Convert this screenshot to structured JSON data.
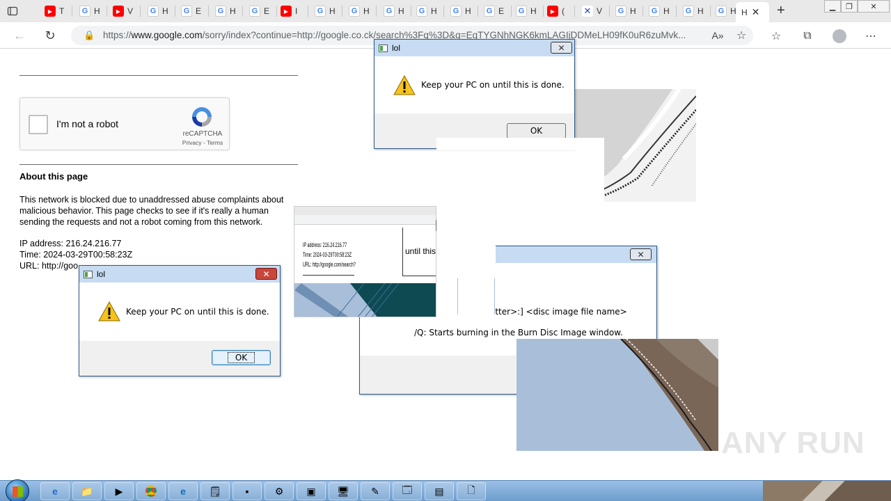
{
  "browser": {
    "tabs": [
      {
        "fav": "yt",
        "label": "T"
      },
      {
        "fav": "g",
        "label": "H"
      },
      {
        "fav": "yt",
        "label": "V"
      },
      {
        "fav": "g",
        "label": "H"
      },
      {
        "fav": "g",
        "label": "E"
      },
      {
        "fav": "g",
        "label": "H"
      },
      {
        "fav": "g",
        "label": "E"
      },
      {
        "fav": "yt",
        "label": "I"
      },
      {
        "fav": "g",
        "label": "H"
      },
      {
        "fav": "g",
        "label": "H"
      },
      {
        "fav": "g",
        "label": "H"
      },
      {
        "fav": "g",
        "label": "H"
      },
      {
        "fav": "g",
        "label": "H"
      },
      {
        "fav": "g",
        "label": "E"
      },
      {
        "fav": "g",
        "label": "H"
      },
      {
        "fav": "yt",
        "label": "("
      },
      {
        "fav": "x",
        "label": "V"
      },
      {
        "fav": "g",
        "label": "H"
      },
      {
        "fav": "g",
        "label": "H"
      },
      {
        "fav": "g",
        "label": "H"
      },
      {
        "fav": "g",
        "label": "H"
      }
    ],
    "active_tab_label": "H",
    "url_prefix": "https://",
    "url_domain": "www.google.com",
    "url_rest": "/sorry/index?continue=http://google.co.ck/search%3Fq%3D&q=EgTYGNhNGK6kmLAGIjDDMeLH09fK0uR6zuMvk..."
  },
  "page": {
    "recaptcha": {
      "label": "I'm not a robot",
      "brand": "reCAPTCHA",
      "links": "Privacy - Terms"
    },
    "about_title": "About this page",
    "about_text": "This network is blocked due to unaddressed abuse complaints about malicious behavior. This page checks to see if it's really a human sending the requests and not a robot coming from this network.",
    "ip_line": "IP address: 216.24.216.77",
    "time_line": "Time: 2024-03-29T00:58:23Z",
    "url_line": "URL: http://goo"
  },
  "dialogs": {
    "top": {
      "title": "lol",
      "message": "Keep your PC on until this is done.",
      "ok": "OK"
    },
    "left": {
      "title": "lol",
      "message": "Keep your PC on until this is done.",
      "ok": "OK"
    },
    "back": {
      "line1": "ive letter>:] <disc image file name>",
      "line2": "/Q: Starts burning in the Burn Disc Image window."
    }
  },
  "glitch": {
    "until_this": "until this",
    "mini_ip": "IP address: 216.24.216.77",
    "mini_time": "Time: 2024-03-29T00:58:23Z",
    "mini_url": "URL: http://google.com/search?"
  },
  "watermark": "ANY RUN",
  "colors": {
    "taskbar": "#6d9ccc",
    "dialog_title": "#c7dcf3",
    "glitch_blue": "#a9bfd9",
    "glitch_teal": "#0e4a52"
  }
}
